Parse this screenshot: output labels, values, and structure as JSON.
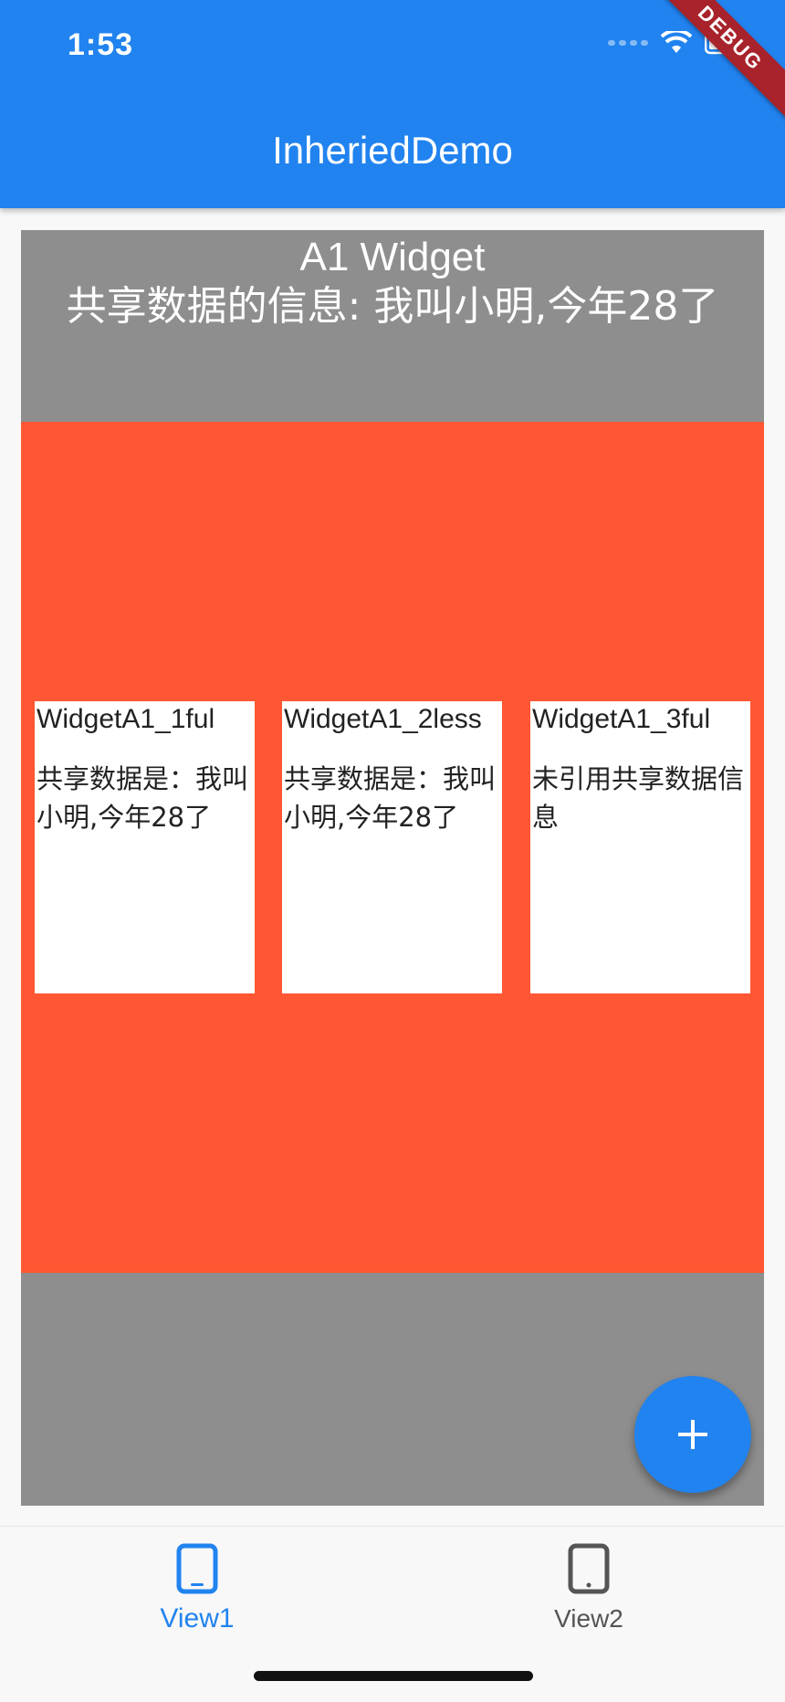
{
  "status_bar": {
    "time": "1:53"
  },
  "debug_banner": "DEBUG",
  "app_bar": {
    "title": "InheriedDemo"
  },
  "a1_widget": {
    "title": "A1 Widget",
    "shared_info": "共享数据的信息: 我叫小明,今年28了"
  },
  "cards": [
    {
      "title": "WidgetA1_1ful",
      "body": "共享数据是：我叫小明,今年28了"
    },
    {
      "title": "WidgetA1_2less",
      "body": "共享数据是：我叫小明,今年28了"
    },
    {
      "title": "WidgetA1_3ful",
      "body": "未引用共享数据信息"
    }
  ],
  "fab": {
    "icon": "plus-icon"
  },
  "bottom_nav": {
    "items": [
      {
        "label": "View1",
        "icon": "phone-icon",
        "selected": true
      },
      {
        "label": "View2",
        "icon": "tablet-icon",
        "selected": false
      }
    ]
  },
  "colors": {
    "primary": "#2183ef",
    "outer_container": "#8e8e8e",
    "inner_container": "#ff5733",
    "card": "#ffffff",
    "unselected_nav": "#555555"
  }
}
